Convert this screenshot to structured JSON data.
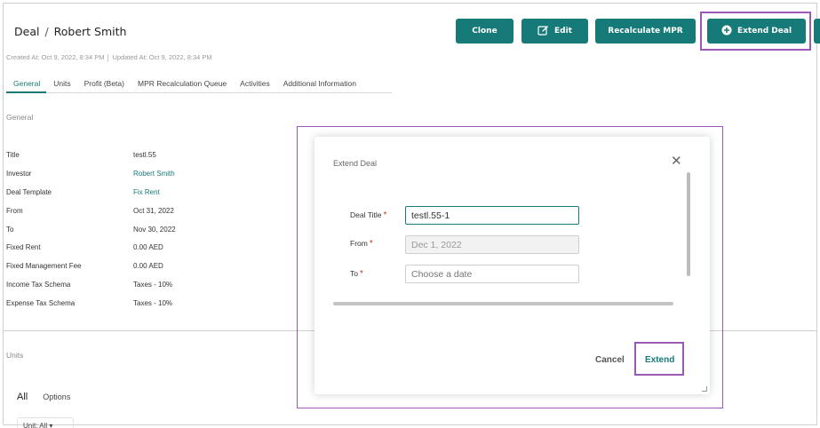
{
  "header": {
    "entity": "Deal",
    "separator": "/",
    "name": "Robert Smith",
    "created": "Created At: Oct 9, 2022, 8:34 PM",
    "updated": "Updated At: Oct 9, 2022, 8:34 PM"
  },
  "toolbar": {
    "clone_label": "Clone",
    "edit_label": "Edit",
    "recalc_label": "Recalculate MPR",
    "extend_label": "Extend Deal",
    "accent": "#167a78"
  },
  "tabs": [
    {
      "label": "General",
      "active": true
    },
    {
      "label": "Units",
      "active": false
    },
    {
      "label": "Profit (Beta)",
      "active": false
    },
    {
      "label": "MPR Recalculation Queue",
      "active": false
    },
    {
      "label": "Activities",
      "active": false
    },
    {
      "label": "Additional Information",
      "active": false
    }
  ],
  "general": {
    "heading": "General",
    "fields": [
      {
        "label": "Title",
        "value": "testl.55"
      },
      {
        "label": "Investor",
        "value": "Robert Smith"
      },
      {
        "label": "Deal Template",
        "value": "Fix Rent"
      },
      {
        "label": "From",
        "value": "Oct 31, 2022"
      },
      {
        "label": "To",
        "value": "Nov 30, 2022"
      },
      {
        "label": "Fixed Rent",
        "value": "0.00 AED"
      },
      {
        "label": "Fixed Management Fee",
        "value": "0.00 AED"
      },
      {
        "label": "Income Tax Schema",
        "value": "Taxes - 10%"
      },
      {
        "label": "Expense Tax Schema",
        "value": "Taxes - 10%"
      }
    ]
  },
  "units": {
    "heading": "Units",
    "tab_all": "All",
    "tab_options": "Options",
    "filter_chip": "Unit: All ▾"
  },
  "modal": {
    "title": "Extend Deal",
    "close_icon": "close-icon",
    "fields": {
      "deal_title": {
        "label": "Deal Title",
        "required_mark": "*",
        "value": "testl.55-1"
      },
      "from": {
        "label": "From",
        "required_mark": "*",
        "value": "Dec 1, 2022"
      },
      "to": {
        "label": "To",
        "required_mark": "*",
        "placeholder": "Choose a date"
      }
    },
    "cancel_label": "Cancel",
    "extend_label": "Extend"
  },
  "highlight_color": "#9b59b6"
}
